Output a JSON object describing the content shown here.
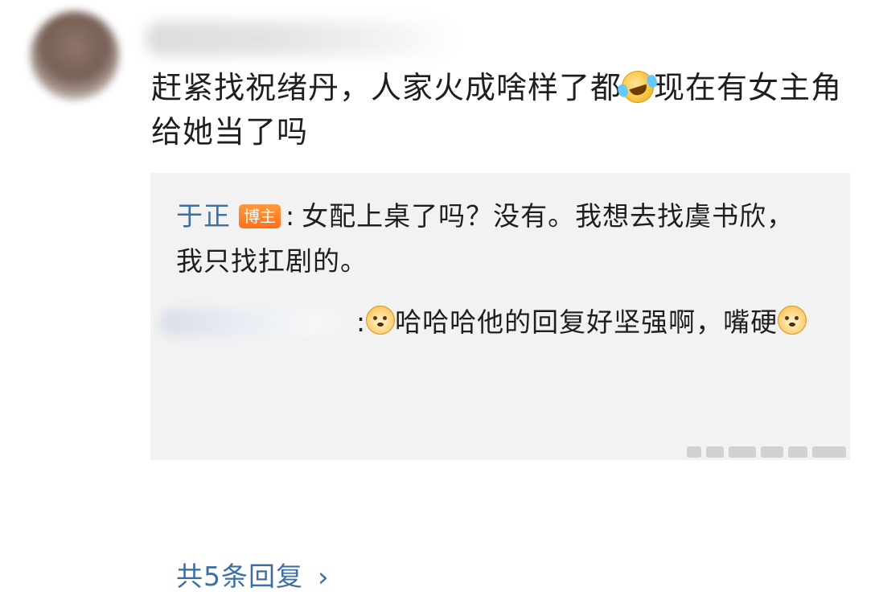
{
  "comment": {
    "text_before_emoji": "赶紧找祝绪丹，人家火成啥样了都",
    "emoji_name": "laugh-cry-icon",
    "text_after_emoji": "现在有女主角给她当了吗"
  },
  "replies": [
    {
      "author": "于正",
      "badge": "博主",
      "separator": ":",
      "text": "女配上桌了吗？没有。我想去找虞书欣，我只找扛剧的。"
    },
    {
      "separator": ":",
      "emoji_name": "doge-icon",
      "text_before_emoji": "哈哈哈他的回复好坚强啊，嘴硬",
      "emoji_after_text": "doge-icon"
    }
  ],
  "more_replies": {
    "label": "共5条回复",
    "chevron": "›"
  }
}
